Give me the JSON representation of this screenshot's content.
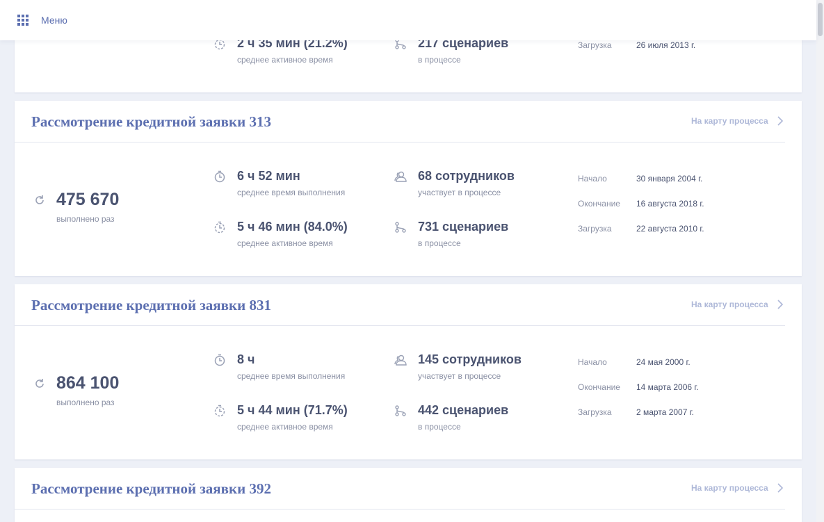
{
  "topbar": {
    "menu_label": "Меню",
    "menu_icon": "grid-icon"
  },
  "partial_card": {
    "active_time": "2 ч 35 мин (21.2%)",
    "active_time_label": "среднее активное время",
    "scenarios": "217 сценариев",
    "scenarios_label": "в процессе",
    "upload_key": "Загрузка",
    "upload_val": "26 июля 2013 г."
  },
  "cards": [
    {
      "title": "Рассмотрение кредитной заявки 313",
      "link": "На карту процесса",
      "runs": "475 670",
      "runs_label": "выполнено раз",
      "avg_time": "6 ч 52 мин",
      "avg_time_label": "среднее время выполнения",
      "active_time": "5 ч 46 мин (84.0%)",
      "active_time_label": "среднее активное время",
      "employees": "68 сотрудников",
      "employees_label": "участвует в процессе",
      "scenarios": "731 сценариев",
      "scenarios_label": "в процессе",
      "start_key": "Начало",
      "start_val": "30 января 2004 г.",
      "end_key": "Окончание",
      "end_val": "16 августа 2018 г.",
      "upload_key": "Загрузка",
      "upload_val": "22 августа 2010 г."
    },
    {
      "title": "Рассмотрение кредитной заявки 831",
      "link": "На карту процесса",
      "runs": "864 100",
      "runs_label": "выполнено раз",
      "avg_time": "8 ч",
      "avg_time_label": "среднее время выполнения",
      "active_time": "5 ч 44 мин (71.7%)",
      "active_time_label": "среднее активное время",
      "employees": "145 сотрудников",
      "employees_label": "участвует в процессе",
      "scenarios": "442 сценариев",
      "scenarios_label": "в процессе",
      "start_key": "Начало",
      "start_val": "24 мая 2000 г.",
      "end_key": "Окончание",
      "end_val": "14 марта 2006 г.",
      "upload_key": "Загрузка",
      "upload_val": "2 марта 2007 г."
    },
    {
      "title": "Рассмотрение кредитной заявки 392",
      "link": "На карту процесса"
    }
  ],
  "colors": {
    "accent": "#5c6fb0",
    "text_dark": "#4a5370",
    "text_muted": "#8a90a4",
    "link": "#aeb8d8"
  }
}
